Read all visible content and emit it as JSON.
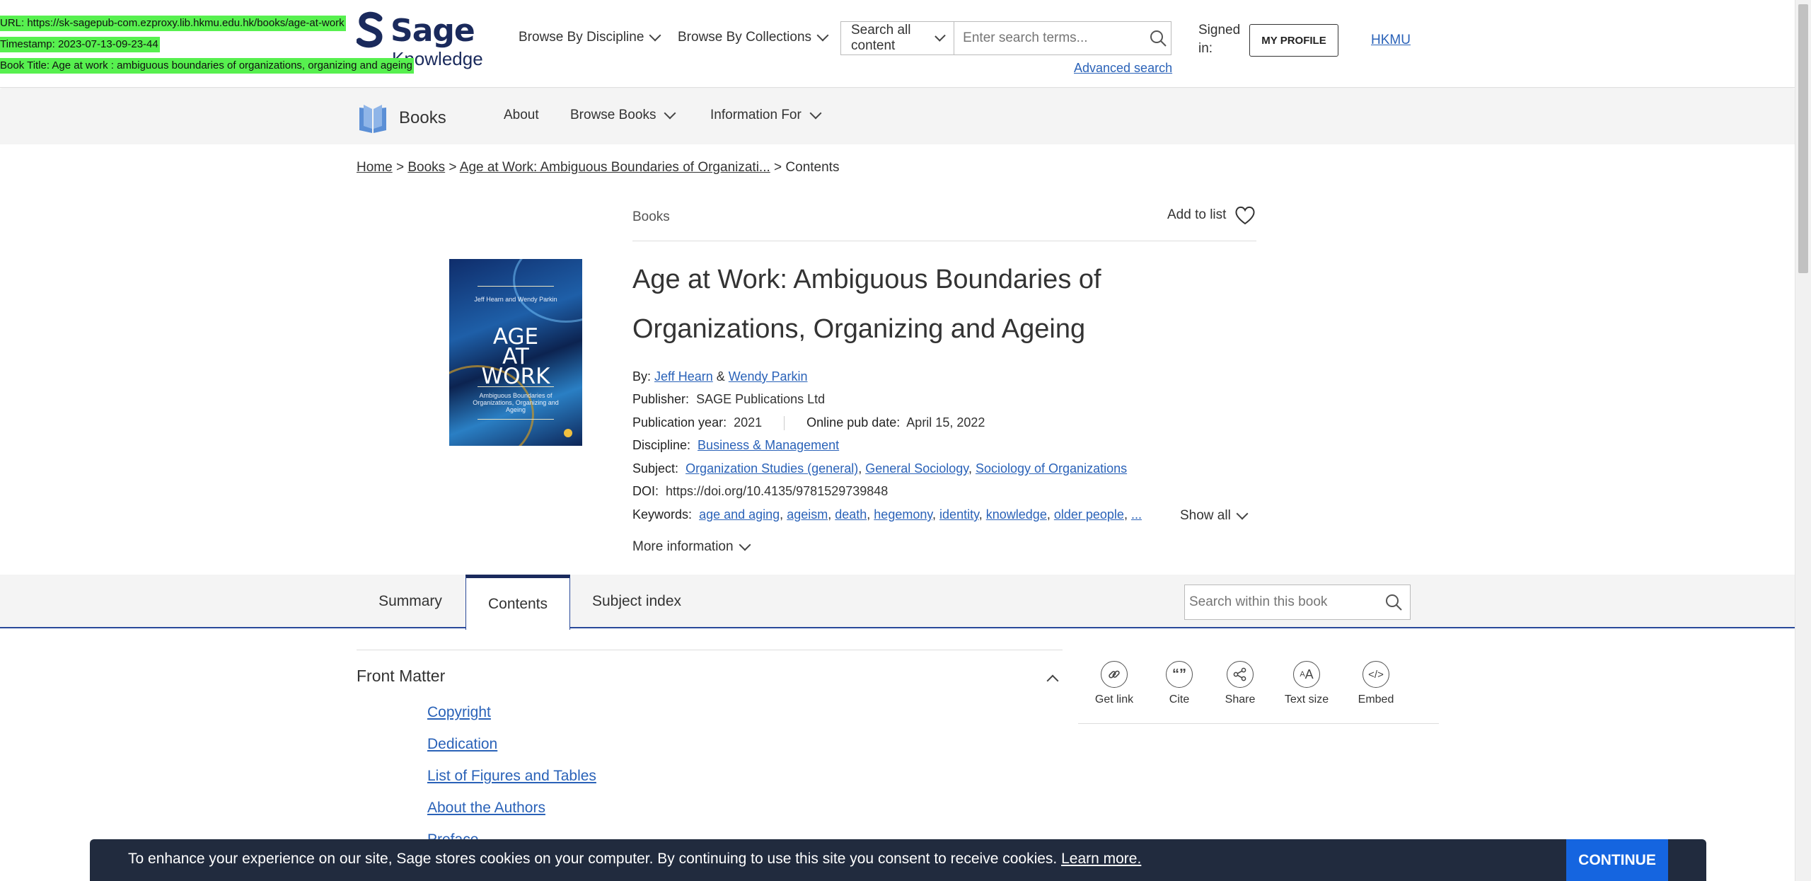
{
  "overlay": {
    "url": "URL: https://sk-sagepub-com.ezproxy.lib.hkmu.edu.hk/books/age-at-work",
    "timestamp": "Timestamp: 2023-07-13-09-23-44",
    "book_title": "Book Title: Age at work : ambiguous boundaries of organizations, organizing and ageing"
  },
  "header": {
    "logo_main": "Sage",
    "logo_sub": "Knowledge",
    "browse_discipline": "Browse By Discipline",
    "browse_collections": "Browse By Collections",
    "search_scope": "Search all content",
    "search_placeholder": "Enter search terms...",
    "advanced_search": "Advanced search",
    "signed_in": "Signed in:",
    "my_profile": "MY PROFILE",
    "institution": "HKMU"
  },
  "subnav": {
    "brand": "Books",
    "about": "About",
    "browse_books": "Browse Books",
    "information_for": "Information For"
  },
  "breadcrumb": {
    "home": "Home",
    "sep1": " > ",
    "books": "Books",
    "sep2": " > ",
    "book": "Age at Work: Ambiguous Boundaries of Organizati...",
    "current": " > Contents"
  },
  "book": {
    "content_type": "Books",
    "add_to_list": "Add to list",
    "title": "Age at Work: Ambiguous Boundaries of Organizations, Organizing and Ageing",
    "by_label": "By:",
    "authors": [
      "Jeff Hearn",
      "Wendy Parkin"
    ],
    "author_sep": " & ",
    "publisher_label": "Publisher:",
    "publisher": "SAGE Publications Ltd",
    "pub_year_label": "Publication year:",
    "pub_year": "2021",
    "online_date_label": "Online pub date:",
    "online_date": "April 15, 2022",
    "discipline_label": "Discipline:",
    "discipline": "Business & Management",
    "subject_label": "Subject:",
    "subjects": [
      "Organization Studies (general)",
      "General Sociology",
      "Sociology of Organizations"
    ],
    "doi_label": "DOI:",
    "doi": "https://doi.org/10.4135/9781529739848",
    "keywords_label": "Keywords:",
    "keywords": [
      "age and aging",
      "ageism",
      "death",
      "hegemony",
      "identity",
      "knowledge",
      "older people",
      "..."
    ],
    "show_all": "Show all",
    "more_information": "More information",
    "cover": {
      "authors": "Jeff Hearn and Wendy Parkin",
      "title_lines": [
        "AGE",
        "AT",
        "WORK"
      ],
      "subtitle": "Ambiguous Boundaries of Organizations, Organizing and Ageing"
    }
  },
  "tabs": [
    "Summary",
    "Contents",
    "Subject index"
  ],
  "active_tab": "Contents",
  "within_search_placeholder": "Search within this book",
  "front_matter": {
    "title": "Front Matter",
    "items": [
      "Copyright",
      "Dedication",
      "List of Figures and Tables",
      "About the Authors",
      "Preface"
    ]
  },
  "tools": [
    {
      "label": "Get link",
      "icon": "link-icon"
    },
    {
      "label": "Cite",
      "icon": "quote-icon"
    },
    {
      "label": "Share",
      "icon": "share-icon"
    },
    {
      "label": "Text size",
      "icon": "text-size-icon"
    },
    {
      "label": "Embed",
      "icon": "code-icon"
    }
  ],
  "cookie": {
    "text": "To enhance your experience on our site, Sage stores cookies on your computer. By continuing to use this site you consent to receive cookies. ",
    "learn_more": "Learn more.",
    "continue": "CONTINUE"
  },
  "colors": {
    "link": "#2a62b8",
    "brand_navy": "#1a2a5c",
    "cookie_bg": "#212b3e",
    "continue_btn": "#1565e0",
    "overlay_green": "#57f04f"
  }
}
